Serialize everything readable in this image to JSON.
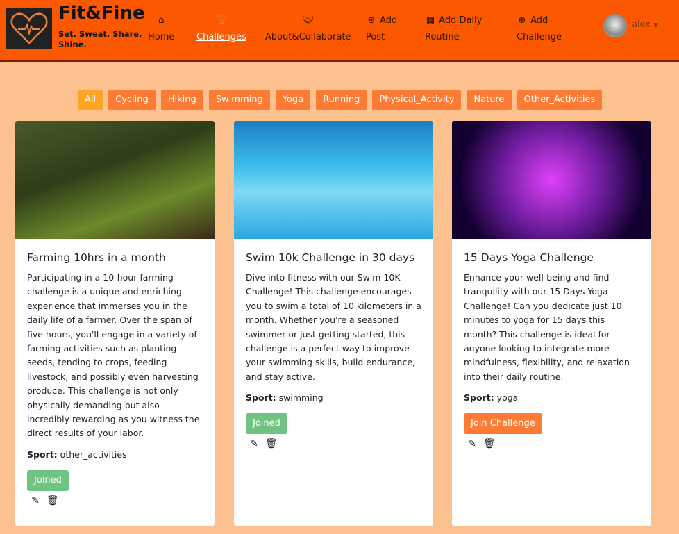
{
  "header": {
    "brand": "Fit&Fine",
    "tagline": "Set. Sweat. Share. Shine.",
    "user": "alex",
    "nav": [
      {
        "label": "Home",
        "icon": "home-icon"
      },
      {
        "label": "Challenges",
        "icon": "trophy-icon"
      },
      {
        "label": "About&Collaborate",
        "icon": "handshake-icon"
      },
      {
        "label": "Add Post",
        "icon": "plus-circle-icon"
      },
      {
        "label": "Add Daily Routine",
        "icon": "calendar-icon"
      },
      {
        "label": "Add Challenge",
        "icon": "plus-circle-icon"
      }
    ]
  },
  "filters": [
    "All",
    "Cycling",
    "Hiking",
    "Swimming",
    "Yoga",
    "Running",
    "Physical_Activity",
    "Nature",
    "Other_Activities"
  ],
  "sport_label": "Sport:",
  "cards": [
    {
      "title": "Farming 10hrs in a month",
      "description": "Participating in a 10-hour farming challenge is a unique and enriching experience that immerses you in the daily life of a farmer. Over the span of five hours, you'll engage in a variety of farming activities such as planting seeds, tending to crops, feeding livestock, and possibly even harvesting produce. This challenge is not only physically demanding but also incredibly rewarding as you witness the direct results of your labor.",
      "sport": "other_activities",
      "button": "Joined"
    },
    {
      "title": "Swim 10k Challenge in 30 days",
      "description": "Dive into fitness with our Swim 10K Challenge! This challenge encourages you to swim a total of 10 kilometers in a month. Whether you're a seasoned swimmer or just getting started, this challenge is a perfect way to improve your swimming skills, build endurance, and stay active.",
      "sport": "swimming",
      "button": "Joined"
    },
    {
      "title": "15 Days Yoga Challenge",
      "description": "Enhance your well-being and find tranquility with our 15 Days Yoga Challenge! Can you dedicate just 10 minutes to yoga for 15 days this month? This challenge is ideal for anyone looking to integrate more mindfulness, flexibility, and relaxation into their daily routine.",
      "sport": "yoga",
      "button": "Join Challenge"
    }
  ],
  "colors": {
    "header": "#fc5800",
    "page": "#fbc28f",
    "filter": "#fd7b34",
    "filter_active": "#ffa526",
    "joined": "#6fc484"
  }
}
